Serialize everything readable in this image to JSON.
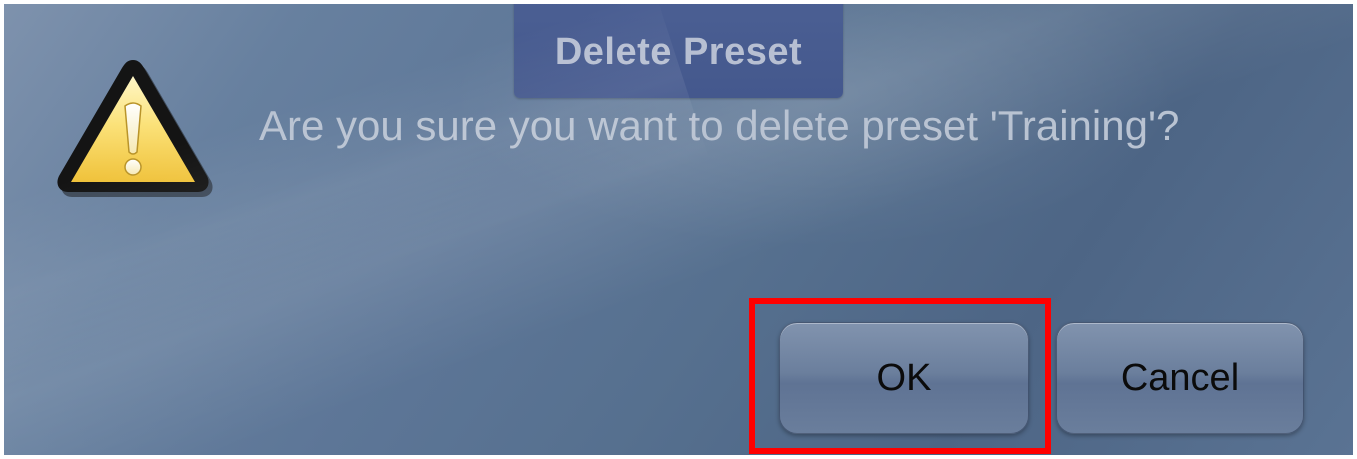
{
  "dialog": {
    "title": "Delete Preset",
    "message": "Are you sure you want to delete preset 'Training'?",
    "icon": "warning-icon",
    "buttons": {
      "ok_label": "OK",
      "cancel_label": "Cancel"
    },
    "highlight_color": "#ff0000",
    "title_bar_color": "#45598e"
  }
}
